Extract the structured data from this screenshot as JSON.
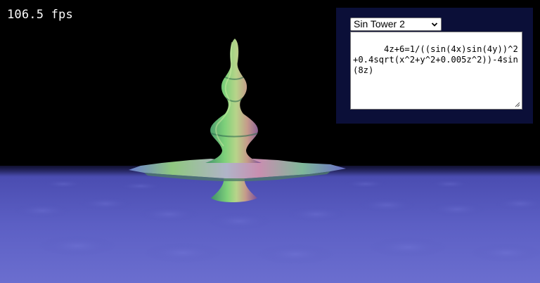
{
  "hud": {
    "fps_text": "106.5 fps"
  },
  "controls": {
    "preset": {
      "selected": "Sin Tower 2",
      "icon": "chevron-down-icon"
    },
    "equation": {
      "value": "4z+6=1/((sin(4x)sin(4y))^2+0.4sqrt(x^2+y^2+0.005z^2))-4sin(8z)"
    }
  },
  "colors": {
    "background": "#000000",
    "panel": "#0b0f38",
    "floor_near": "#6a6ed0",
    "floor_far": "#3d3fa0"
  }
}
